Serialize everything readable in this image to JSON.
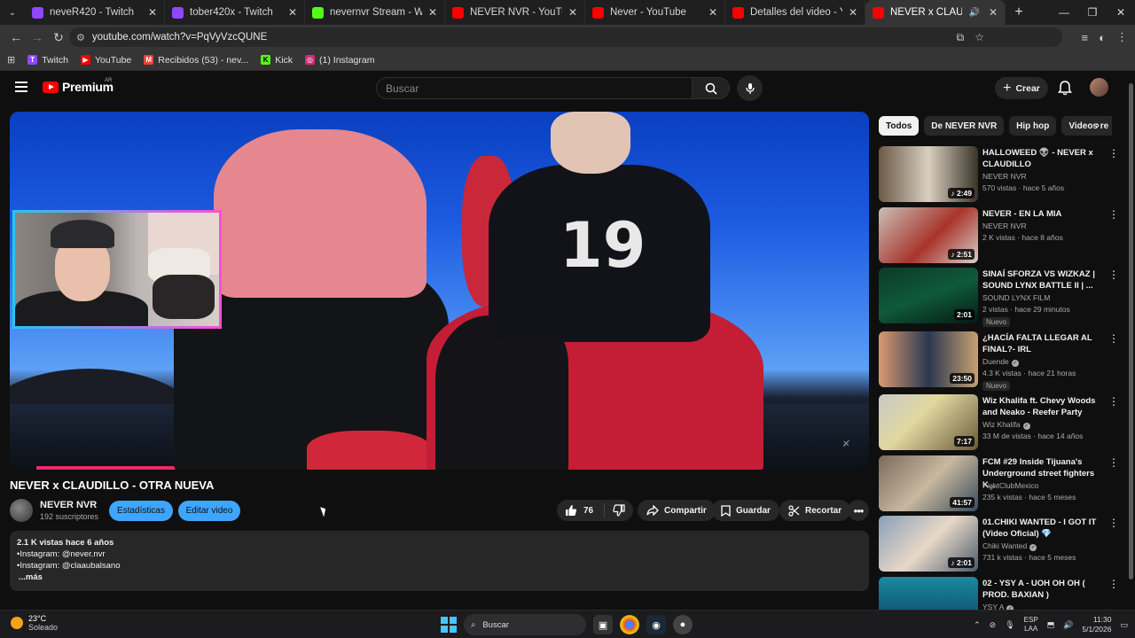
{
  "browser": {
    "tabs": [
      {
        "title": "neveR420 - Twitch",
        "favicon": "twitch",
        "color": "#9146ff",
        "active": false
      },
      {
        "title": "tober420x - Twitch",
        "favicon": "twitch",
        "color": "#9146ff",
        "active": false
      },
      {
        "title": "nevernvr Stream - Watch Live o",
        "favicon": "kick",
        "color": "#53fc18",
        "active": false
      },
      {
        "title": "NEVER NVR - YouTube",
        "favicon": "youtube",
        "color": "#ff0000",
        "active": false
      },
      {
        "title": "Never - YouTube",
        "favicon": "youtube",
        "color": "#ff0000",
        "active": false
      },
      {
        "title": "Detalles del video - YouTube St",
        "favicon": "youtube-studio",
        "color": "#ff0000",
        "active": false
      },
      {
        "title": "NEVER x CLAUDILLO - OTR",
        "favicon": "youtube",
        "color": "#ff0000",
        "active": true
      }
    ],
    "url": "youtube.com/watch?v=PqVyVzcQUNE",
    "bookmarks": [
      {
        "label": "Twitch",
        "color": "#9146ff",
        "icon": "T"
      },
      {
        "label": "YouTube",
        "color": "#ff0000",
        "icon": "▶"
      },
      {
        "label": "Recibidos (53) - nev...",
        "color": "#ea4335",
        "icon": "M"
      },
      {
        "label": "Kick",
        "color": "#53fc18",
        "icon": "K"
      },
      {
        "label": "(1) Instagram",
        "color": "#d62976",
        "icon": "◎"
      }
    ]
  },
  "youtube": {
    "brand": "Premium",
    "country": "AR",
    "search_placeholder": "Buscar",
    "create_label": "Crear"
  },
  "video": {
    "title": "NEVER x CLAUDILLO - OTRA NUEVA",
    "channel": "NEVER NVR",
    "subscribers": "192 suscriptores",
    "stats_button": "Estadísticas",
    "edit_button": "Editar video",
    "likes": "76",
    "share": "Compartir",
    "save": "Guardar",
    "clip": "Recortar",
    "description": {
      "stats": "2.1 K vistas  hace 6 años",
      "line1": "•Instagram: @never.nvr",
      "line2": "•Instagram: @claaubalsano",
      "more": "...más"
    }
  },
  "sidebar": {
    "chips": [
      "Todos",
      "De NEVER NVR",
      "Hip hop",
      "Videos re"
    ],
    "recommendations": [
      {
        "title": "HALLOWEED 👽 - NEVER x CLAUDILLO",
        "channel": "NEVER NVR",
        "views": "570 vistas · hace 5 años",
        "duration": "2:49",
        "shorts": true,
        "verified": false,
        "badge": ""
      },
      {
        "title": "NEVER - EN LA MIA",
        "channel": "NEVER NVR",
        "views": "2 K vistas · hace 8 años",
        "duration": "2:51",
        "shorts": true,
        "verified": false,
        "badge": ""
      },
      {
        "title": "SINAÍ SFORZA VS WIZKAZ | SOUND LYNX BATTLE II | ...",
        "channel": "SOUND LYNX FILM",
        "views": "2 vistas · hace 29 minutos",
        "duration": "2:01",
        "shorts": false,
        "verified": false,
        "badge": "Nuevo"
      },
      {
        "title": "¿HACÍA FALTA LLEGAR AL FINAL?- IRL",
        "channel": "Duende",
        "views": "4.3 K vistas · hace 21 horas",
        "duration": "23:50",
        "shorts": false,
        "verified": true,
        "badge": "Nuevo"
      },
      {
        "title": "Wiz Khalifa ft. Chevy Woods and Neako - Reefer Party",
        "channel": "Wiz Khalifa",
        "views": "33 M de vistas · hace 14 años",
        "duration": "7:17",
        "shorts": false,
        "verified": true,
        "badge": ""
      },
      {
        "title": "FCM #29  Inside Tijuana's Underground street fighters K...",
        "channel": "FightClubMexico",
        "views": "235 k vistas · hace 5 meses",
        "duration": "41:57",
        "shorts": false,
        "verified": false,
        "badge": ""
      },
      {
        "title": "01.CHIKI WANTED - I GOT IT (Video Oficial) 💎",
        "channel": "Chiki Wanted",
        "views": "731 k vistas · hace 5 meses",
        "duration": "2:01",
        "shorts": true,
        "verified": true,
        "badge": ""
      },
      {
        "title": "02 - YSY A - UOH OH OH ( PROD. BAXIAN )",
        "channel": "YSY A",
        "views": "",
        "duration": "",
        "shorts": false,
        "verified": true,
        "badge": ""
      }
    ]
  },
  "taskbar": {
    "temperature": "23°C",
    "weather": "Soleado",
    "search": "Buscar",
    "lang1": "ESP",
    "lang2": "LAA",
    "time": "11:30",
    "date": "5/1/2026"
  }
}
